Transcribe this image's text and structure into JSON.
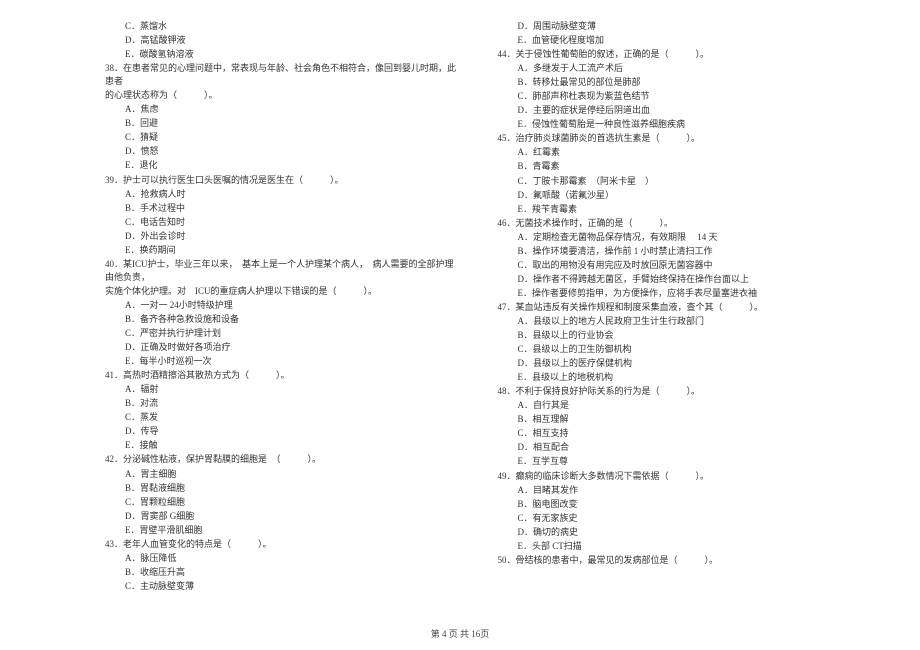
{
  "left_column": [
    {
      "type": "option",
      "text": "C．蒸馏水"
    },
    {
      "type": "option",
      "text": "D．高锰酸钾液"
    },
    {
      "type": "option",
      "text": "E．碳酸氢钠溶液"
    },
    {
      "type": "question",
      "text": "38．在患者常见的心理问题中，常表现与年龄、社会角色不相符合，像回到婴儿时期，此患者"
    },
    {
      "type": "question",
      "text": "的心理状态称为（　　　）。"
    },
    {
      "type": "option",
      "text": "A．焦虑"
    },
    {
      "type": "option",
      "text": "B．回避"
    },
    {
      "type": "option",
      "text": "C．猜疑"
    },
    {
      "type": "option",
      "text": "D．愤怒"
    },
    {
      "type": "option",
      "text": "E．退化"
    },
    {
      "type": "question",
      "text": "39．护士可以执行医生口头医嘱的情况是医生在（　　　）。"
    },
    {
      "type": "option",
      "text": "A．抢救病人时"
    },
    {
      "type": "option",
      "text": "B．手术过程中"
    },
    {
      "type": "option",
      "text": "C．电话告知时"
    },
    {
      "type": "option",
      "text": "D．外出会诊时"
    },
    {
      "type": "option",
      "text": "E．换药期间"
    },
    {
      "type": "question",
      "text": "40．某ICU护士，毕业三年以来，　基本上是一个人护理某个病人，　病人需要的全部护理由他负责，"
    },
    {
      "type": "question",
      "text": "实施个体化护理。对　ICU的重症病人护理以下错误的是（　　　）。"
    },
    {
      "type": "option",
      "text": "A．一对一 24小时特级护理"
    },
    {
      "type": "option",
      "text": "B．备齐各种急救设施和设备"
    },
    {
      "type": "option",
      "text": "C．严密并执行护理计划"
    },
    {
      "type": "option",
      "text": "D．正确及时做好各项治疗"
    },
    {
      "type": "option",
      "text": "E．每半小时巡视一次"
    },
    {
      "type": "question",
      "text": "41．高热时酒精擦浴其散热方式为（　　　）。"
    },
    {
      "type": "option",
      "text": "A．辐射"
    },
    {
      "type": "option",
      "text": "B．对流"
    },
    {
      "type": "option",
      "text": "C．蒸发"
    },
    {
      "type": "option",
      "text": "D．传导"
    },
    {
      "type": "option",
      "text": "E．接触"
    },
    {
      "type": "question",
      "text": "42．分泌碱性粘液，保护胃黏膜的细胞是　（　　　）。"
    },
    {
      "type": "option",
      "text": "A．胃主细胞"
    },
    {
      "type": "option",
      "text": "B．胃黏液细胞"
    },
    {
      "type": "option",
      "text": "C．胃颗粒细胞"
    },
    {
      "type": "option",
      "text": "D．胃窦部 G细胞"
    },
    {
      "type": "option",
      "text": "E．胃壁平滑肌细胞"
    },
    {
      "type": "question",
      "text": "43．老年人血管变化的特点是（　　　）。"
    },
    {
      "type": "option",
      "text": "A．脉压降低"
    },
    {
      "type": "option",
      "text": "B．收缩压升高"
    },
    {
      "type": "option",
      "text": "C．主动脉壁变薄"
    }
  ],
  "right_column": [
    {
      "type": "option",
      "text": "D．周围动脉壁变薄"
    },
    {
      "type": "option",
      "text": "E．血管硬化程度增加"
    },
    {
      "type": "question",
      "text": "44．关于侵蚀性葡萄胎的叙述，正确的是（　　　）。"
    },
    {
      "type": "option",
      "text": "A．多继发于人工流产术后"
    },
    {
      "type": "option",
      "text": "B．转移灶最常见的部位是肺部"
    },
    {
      "type": "option",
      "text": "C．肺部声称杜表现为紫蓝色结节"
    },
    {
      "type": "option",
      "text": "D．主要的症状是停经后阴道出血"
    },
    {
      "type": "option",
      "text": "E．侵蚀性葡萄胎是一种良性滋养细胞疾病"
    },
    {
      "type": "question",
      "text": "45．治疗肺炎球菌肺炎的首选抗生素是（　　　）。"
    },
    {
      "type": "option",
      "text": "A．红霉素"
    },
    {
      "type": "option",
      "text": "B．青霉素"
    },
    {
      "type": "option",
      "text": "C．丁胺卡那霉素　（阿米卡星　）"
    },
    {
      "type": "option",
      "text": "D．氟哌酸（诺氟沙星）"
    },
    {
      "type": "option",
      "text": "E．羧苄青霉素"
    },
    {
      "type": "question",
      "text": "46．无菌技术操作时，正确的是（　　　）。"
    },
    {
      "type": "option",
      "text": "A．定期检查无菌物品保存情况，有效期限　 14 天"
    },
    {
      "type": "option",
      "text": "B．操作环境要清洁，操作前 1 小时禁止清扫工作"
    },
    {
      "type": "option",
      "text": "C．取出的用物没有用完应及时放回原无菌容器中"
    },
    {
      "type": "option",
      "text": "D．操作者不得跨越无菌区，手臂始终保持在操作台面以上"
    },
    {
      "type": "option",
      "text": "E．操作者要修剪指甲，为方便操作，应将手表尽量塞进衣袖"
    },
    {
      "type": "question",
      "text": "47．某血站违反有关操作规程和制度采集血液，查个其（　　　）。"
    },
    {
      "type": "option",
      "text": "A．县级以上的地方人民政府卫生计生行政部门"
    },
    {
      "type": "option",
      "text": "B．县级以上的行业协会"
    },
    {
      "type": "option",
      "text": "C．县级以上的卫生防御机构"
    },
    {
      "type": "option",
      "text": "D．县级以上的医疗保健机构"
    },
    {
      "type": "option",
      "text": "E．县级以上的地税机构"
    },
    {
      "type": "question",
      "text": "48．不利于保持良好护际关系的行为是（　　　）。"
    },
    {
      "type": "option",
      "text": "A．自行其是"
    },
    {
      "type": "option",
      "text": "B．相互理解"
    },
    {
      "type": "option",
      "text": "C．相互支持"
    },
    {
      "type": "option",
      "text": "D．相互配合"
    },
    {
      "type": "option",
      "text": "E．互学互尊"
    },
    {
      "type": "question",
      "text": "49．癫痫的临床诊断大多数情况下需依据（　　　）。"
    },
    {
      "type": "option",
      "text": "A．目睹其发作"
    },
    {
      "type": "option",
      "text": "B．脑电图改变"
    },
    {
      "type": "option",
      "text": "C．有无家族史"
    },
    {
      "type": "option",
      "text": "D．确切的病史"
    },
    {
      "type": "option",
      "text": "E．头部 CT扫描"
    },
    {
      "type": "question",
      "text": "50．骨结核的患者中，最常见的发病部位是（　　　）。"
    }
  ],
  "footer": "第 4 页 共 16页"
}
